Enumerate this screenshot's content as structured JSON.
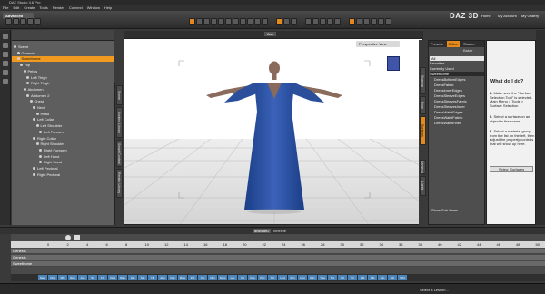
{
  "titlebar": {
    "title": "DAZ Studio 4.6 Pro"
  },
  "menu": [
    "File",
    "Edit",
    "Create",
    "Tools",
    "Render",
    "Connect",
    "Window",
    "Help"
  ],
  "layout_badge": "Advanced",
  "logo": "DAZ 3D",
  "top_links": [
    "Home",
    "My Account",
    "My Gallery"
  ],
  "scene": {
    "tab": "Scene",
    "rows": [
      {
        "label": "Scene",
        "indent": 0,
        "selected": false
      },
      {
        "label": "Genesis",
        "indent": 1,
        "selected": false
      },
      {
        "label": "Sweethome",
        "indent": 1,
        "selected": true
      },
      {
        "label": "Hip",
        "indent": 2,
        "selected": false
      },
      {
        "label": "Pelvis",
        "indent": 3,
        "selected": false
      },
      {
        "label": "Left Thigh",
        "indent": 4,
        "selected": false
      },
      {
        "label": "Right Thigh",
        "indent": 4,
        "selected": false
      },
      {
        "label": "Abdomen",
        "indent": 3,
        "selected": false
      },
      {
        "label": "Abdomen 2",
        "indent": 4,
        "selected": false
      },
      {
        "label": "Chest",
        "indent": 5,
        "selected": false
      },
      {
        "label": "Neck",
        "indent": 6,
        "selected": false
      },
      {
        "label": "Head",
        "indent": 7,
        "selected": false
      },
      {
        "label": "Left Collar",
        "indent": 6,
        "selected": false
      },
      {
        "label": "Left Shoulder",
        "indent": 7,
        "selected": false
      },
      {
        "label": "Left Forearm",
        "indent": 8,
        "selected": false
      },
      {
        "label": "Right Collar",
        "indent": 6,
        "selected": false
      },
      {
        "label": "Right Shoulder",
        "indent": 7,
        "selected": false
      },
      {
        "label": "Right Forearm",
        "indent": 8,
        "selected": false
      },
      {
        "label": "Left Hand",
        "indent": 8,
        "selected": false
      },
      {
        "label": "Right Hand",
        "indent": 8,
        "selected": false
      },
      {
        "label": "Left Pectoral",
        "indent": 6,
        "selected": false
      },
      {
        "label": "Right Pectoral",
        "indent": 6,
        "selected": false
      }
    ]
  },
  "left_vtabs": [
    "Scene",
    "Content Library",
    "Smart Content",
    "Render Library"
  ],
  "viewport": {
    "tab": "Aux",
    "camera": "Perspective View"
  },
  "surfaces": {
    "tabs": [
      "Presets",
      "Editor",
      "Shader Baker"
    ],
    "header": "All",
    "rows": [
      "Favorites",
      "Currently Used",
      "Sweethome",
      "DressBottomEdges",
      "DressFabric",
      "DressInnerEdges",
      "DressSleeveEdges",
      "DressSleevesFabric",
      "DressSleevesInner",
      "DressWaistEdges",
      "DressWaistFabric",
      "DressWaistInner"
    ],
    "show_sub_items": "Show Sub Items"
  },
  "right_vtabs": [
    "Shaping",
    "Pose",
    "Surfaces",
    "Lights",
    "Cameras"
  ],
  "help": {
    "title": "What do I do?",
    "steps": [
      "Make sure the \"Surface Selection Tool\" is selected. Main Menu > Tools > Surface Selection",
      "Select a surface on an object in the scene.",
      "Select a material group from the list on the left, then adjust the property controls that will show up here."
    ],
    "video_button": "Video: Surfaces"
  },
  "timeline": {
    "tabs": [
      "aniMate2",
      "Timeline"
    ],
    "tracks": [
      "Genesis",
      "Genesis",
      "Sweethome"
    ],
    "ruler_marks": [
      "0",
      "2",
      "4",
      "6",
      "8",
      "10",
      "12",
      "14",
      "16",
      "18",
      "20",
      "22",
      "24",
      "26",
      "28",
      "30",
      "32",
      "34",
      "36",
      "38",
      "40",
      "42",
      "44",
      "46",
      "48",
      "50"
    ],
    "poses": [
      "Sam",
      "Cha",
      "Wlk",
      "Run",
      "Jog",
      "Sit",
      "Fly",
      "Nod",
      "Wav",
      "Hlo",
      "Stp",
      "Tlk",
      "Jmp",
      "Kck",
      "Bow",
      "Pnt",
      "Clp",
      "Dnc",
      "Swm",
      "Lay",
      "Crl",
      "Kne",
      "Pnc",
      "Thr",
      "Lnd",
      "Spn",
      "Hop",
      "Rdy",
      "Yaw",
      "Tpr",
      "Idl",
      "Str",
      "Wlt",
      "Clb",
      "Stn",
      "Glt",
      "Wht"
    ]
  },
  "status": {
    "lessons": "Select a Lesson..."
  }
}
